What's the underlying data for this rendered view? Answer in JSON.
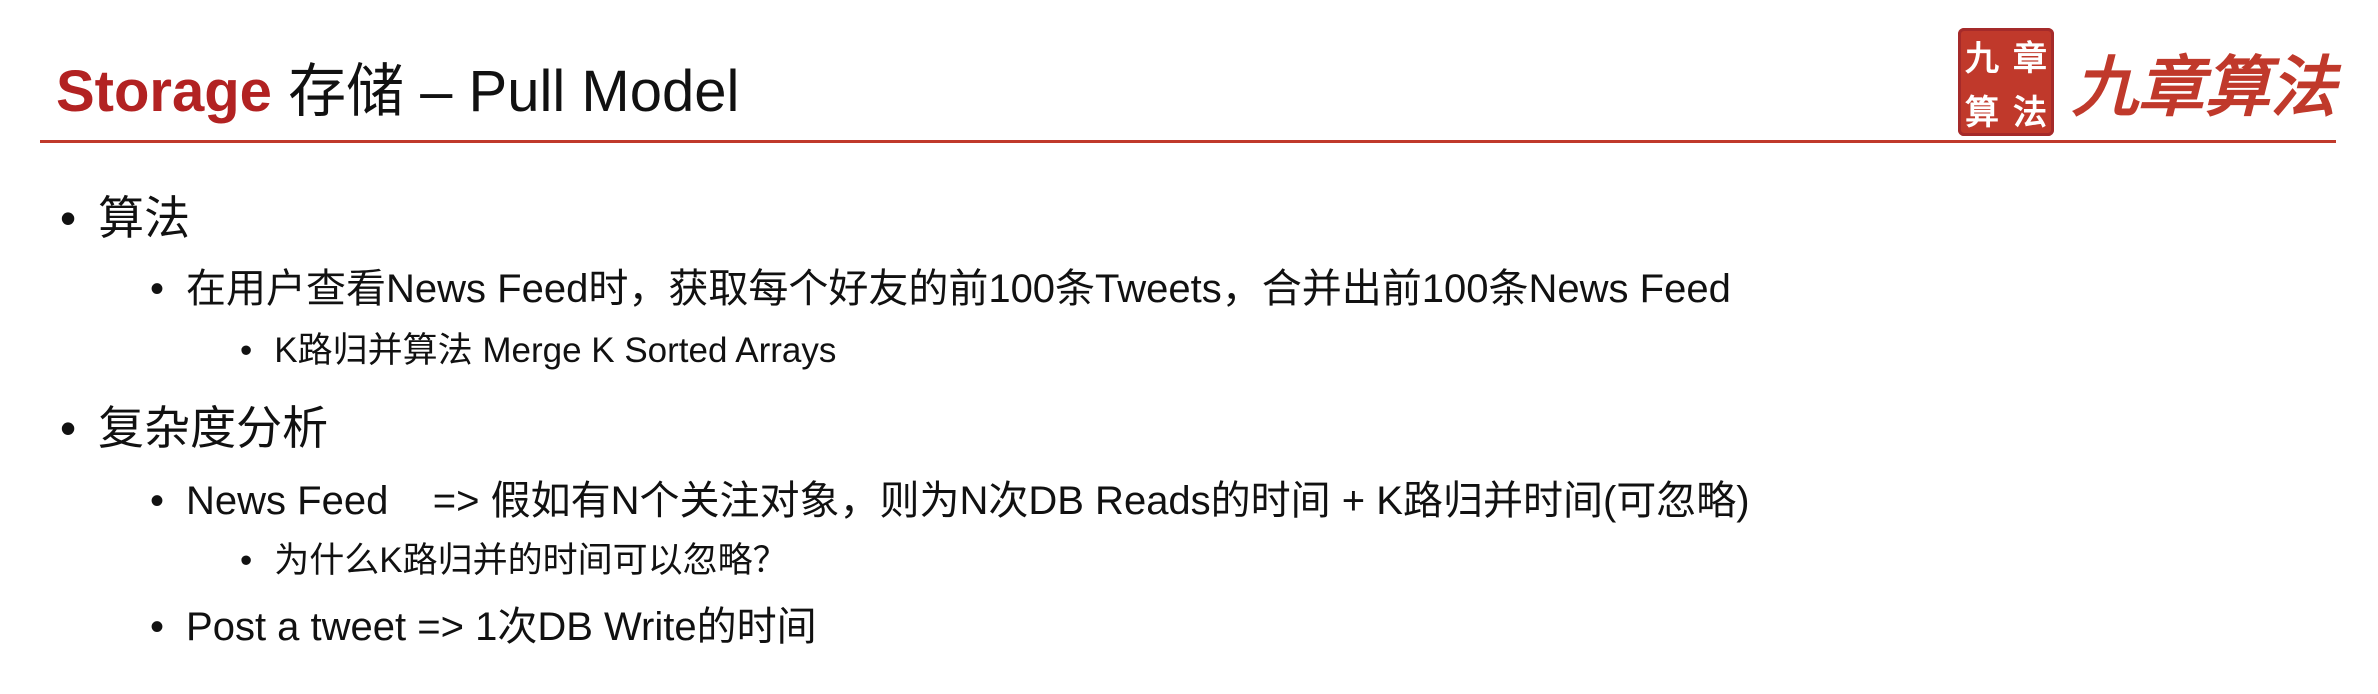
{
  "title": {
    "accent": "Storage",
    "rest": " 存储 – Pull Model"
  },
  "logo": {
    "seal_chars": [
      "九",
      "章",
      "算",
      "法"
    ],
    "text": "九章算法"
  },
  "bullets": [
    {
      "level": 1,
      "text": "算法"
    },
    {
      "level": 2,
      "text": "在用户查看News Feed时，获取每个好友的前100条Tweets，合并出前100条News Feed"
    },
    {
      "level": 3,
      "text": "K路归并算法 Merge K Sorted Arrays"
    },
    {
      "level": 1,
      "text": "复杂度分析"
    },
    {
      "level": 2,
      "text": "News Feed    => 假如有N个关注对象，则为N次DB Reads的时间 + K路归并时间(可忽略)"
    },
    {
      "level": 3,
      "text": "为什么K路归并的时间可以忽略？"
    },
    {
      "level": 2,
      "text": "Post a tweet => 1次DB Write的时间"
    }
  ],
  "colors": {
    "accent": "#b22222",
    "rule": "#c0392b"
  }
}
